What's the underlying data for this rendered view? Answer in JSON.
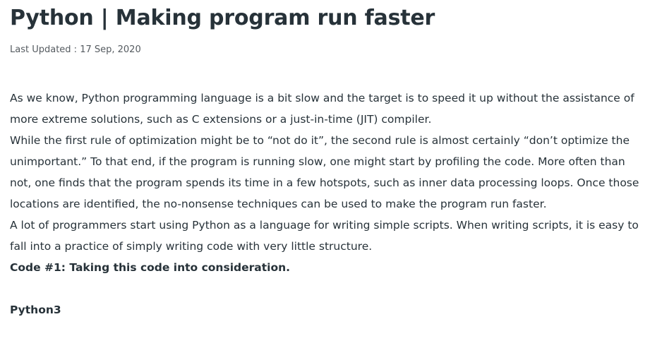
{
  "article": {
    "title": "Python | Making program run faster",
    "last_updated": "Last Updated : 17 Sep, 2020",
    "paragraphs": [
      "As we know, Python programming language is a bit slow and the target is to speed it up without the assistance of more extreme solutions, such as C extensions or a just-in-time (JIT) compiler.",
      "While the first rule of optimization might be to “not do it”, the second rule is almost certainly “don’t optimize the unimportant.” To that end, if the program is running slow, one might start by profiling the code. More often than not, one finds that the program spends its time in a few hotspots, such as inner data processing loops. Once those locations are identified, the no-nonsense techniques can be used to make the program run faster.",
      "A lot of programmers start using Python as a language for writing simple scripts. When writing scripts, it is easy to fall into a practice of simply writing code with very little structure."
    ],
    "code_heading": "Code #1: Taking this code into consideration.",
    "language_tab": "Python3"
  }
}
